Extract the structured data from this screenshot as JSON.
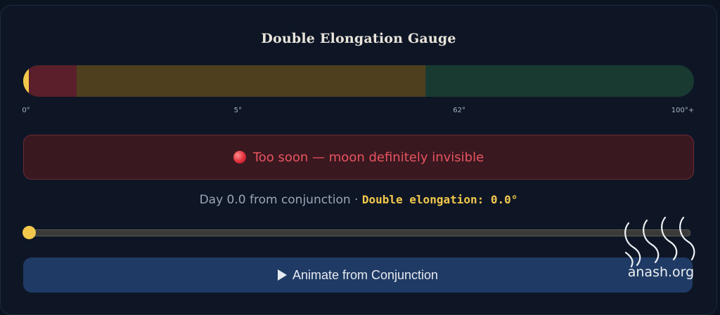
{
  "title": "Double Elongation Gauge",
  "gauge": {
    "indicator_value": 0.0,
    "zones": [
      {
        "name": "red",
        "from_pct": 0,
        "to_pct": 8,
        "color": "#5a1f2a"
      },
      {
        "name": "yellow",
        "from_pct": 8,
        "to_pct": 60,
        "color": "#4e3f1e"
      },
      {
        "name": "green",
        "from_pct": 60,
        "to_pct": 100,
        "color": "#193a31"
      }
    ],
    "ticks": [
      {
        "label": "0°",
        "pct": 0
      },
      {
        "label": "5°",
        "pct": 32
      },
      {
        "label": "62°",
        "pct": 65
      },
      {
        "label": "100°+",
        "pct": 100
      }
    ]
  },
  "status": {
    "text": "Too soon — moon definitely invisible",
    "icon": "red-circle-icon",
    "color": "#e8545f"
  },
  "info": {
    "day_text": "Day 0.0 from conjunction · ",
    "elongation_text": "Double elongation: 0.0°"
  },
  "slider": {
    "value_pct": 0
  },
  "animate_button": {
    "label": "Animate from Conjunction",
    "icon": "play-icon"
  },
  "watermark": {
    "text": "anash.org"
  }
}
